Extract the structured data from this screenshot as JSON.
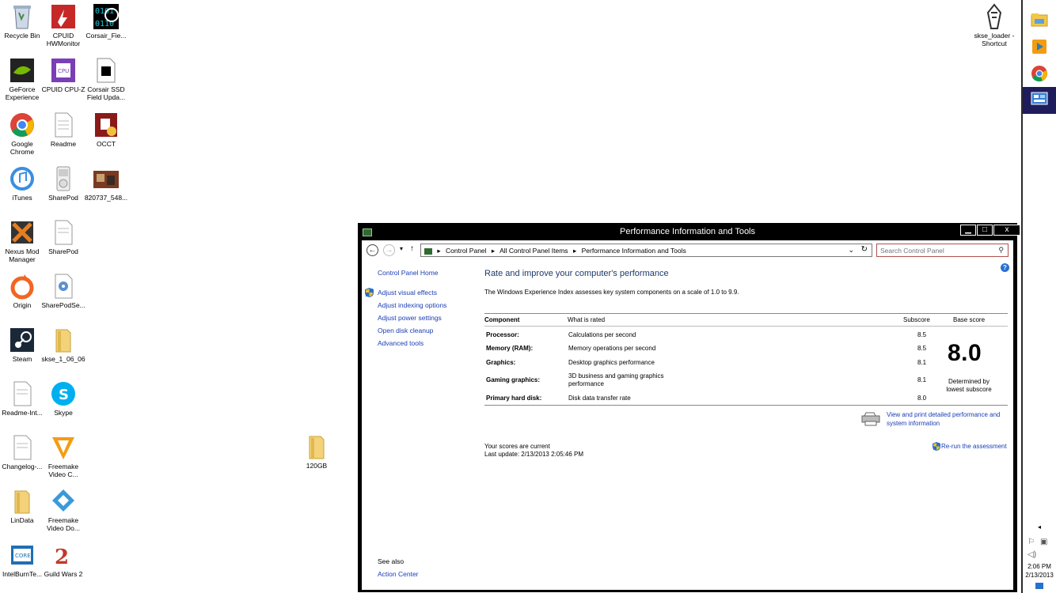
{
  "desktop": {
    "icons": [
      {
        "label": "Recycle Bin",
        "icon": "recycle-bin-icon"
      },
      {
        "label": "CPUID HWMonitor",
        "icon": "hwmonitor-icon"
      },
      {
        "label": "Corsair_Fie...",
        "icon": "corsair-binary-icon"
      },
      {
        "label": "GeForce Experience",
        "icon": "geforce-icon"
      },
      {
        "label": "CPUID CPU-Z",
        "icon": "cpuz-icon"
      },
      {
        "label": "Corsair SSD Field Upda...",
        "icon": "corsair-ssd-icon"
      },
      {
        "label": "Google Chrome",
        "icon": "chrome-icon"
      },
      {
        "label": "Readme",
        "icon": "text-file-icon"
      },
      {
        "label": "OCCT",
        "icon": "occt-icon"
      },
      {
        "label": "iTunes",
        "icon": "itunes-icon"
      },
      {
        "label": "SharePod",
        "icon": "ipod-icon"
      },
      {
        "label": "820737_548...",
        "icon": "image-file-icon"
      },
      {
        "label": "Nexus Mod Manager",
        "icon": "nexus-icon"
      },
      {
        "label": "SharePod",
        "icon": "text-file-icon"
      },
      {
        "label": "Origin",
        "icon": "origin-icon"
      },
      {
        "label": "SharePodSe...",
        "icon": "settings-file-icon"
      },
      {
        "label": "Steam",
        "icon": "steam-icon"
      },
      {
        "label": "skse_1_06_06",
        "icon": "folder-icon"
      },
      {
        "label": "Readme-Int...",
        "icon": "text-file-icon"
      },
      {
        "label": "Skype",
        "icon": "skype-icon"
      },
      {
        "label": "Changelog-...",
        "icon": "text-file-icon"
      },
      {
        "label": "Freemake Video C...",
        "icon": "freemake-converter-icon"
      },
      {
        "label": "LinData",
        "icon": "folder-icon"
      },
      {
        "label": "Freemake Video Do...",
        "icon": "freemake-downloader-icon"
      },
      {
        "label": "IntelBurnTe...",
        "icon": "intel-icon"
      },
      {
        "label": "Guild Wars 2",
        "icon": "guildwars-icon"
      },
      {
        "label": "120GB",
        "icon": "folder-icon"
      },
      {
        "label": "skse_loader - Shortcut",
        "icon": "skyrim-icon"
      }
    ]
  },
  "taskbar": {
    "items": [
      "file-explorer-icon",
      "media-player-icon",
      "chrome-icon",
      "control-panel-icon"
    ],
    "tray_arrow": "◂",
    "time": "2:06 PM",
    "date": "2/13/2013"
  },
  "window": {
    "title": "Performance Information and Tools",
    "min": "▁",
    "max": "□",
    "close": "x",
    "breadcrumbs": [
      "Control Panel",
      "All Control Panel Items",
      "Performance Information and Tools"
    ],
    "search_placeholder": "Search Control Panel",
    "help": "?"
  },
  "left_pane": {
    "home": "Control Panel Home",
    "links": [
      "Adjust visual effects",
      "Adjust indexing options",
      "Adjust power settings",
      "Open disk cleanup",
      "Advanced tools"
    ],
    "see_also": "See also",
    "action_center": "Action Center"
  },
  "main": {
    "heading": "Rate and improve your computer's performance",
    "description": "The Windows Experience Index assesses key system components on a scale of 1.0 to 9.9.",
    "columns": {
      "component": "Component",
      "rated": "What is rated",
      "subscore": "Subscore",
      "base": "Base score"
    },
    "rows": [
      {
        "component": "Processor:",
        "rated": "Calculations per second",
        "subscore": "8.5"
      },
      {
        "component": "Memory (RAM):",
        "rated": "Memory operations per second",
        "subscore": "8.5"
      },
      {
        "component": "Graphics:",
        "rated": "Desktop graphics performance",
        "subscore": "8.1"
      },
      {
        "component": "Gaming graphics:",
        "rated": "3D business and gaming graphics performance",
        "subscore": "8.1"
      },
      {
        "component": "Primary hard disk:",
        "rated": "Disk data transfer rate",
        "subscore": "8.0"
      }
    ],
    "base_score": "8.0",
    "base_note": "Determined by lowest subscore",
    "print_link": "View and print detailed performance and system information",
    "status_line1": "Your scores are current",
    "status_line2": "Last update: 2/13/2013 2:05:46 PM",
    "rerun": "Re-run the assessment"
  }
}
